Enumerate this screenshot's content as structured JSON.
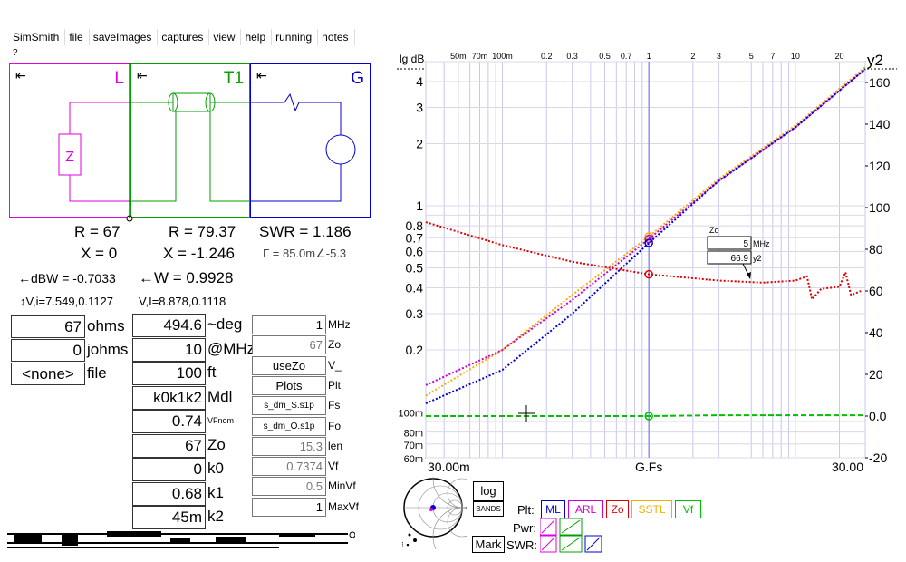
{
  "menu": [
    "SimSmith",
    "file",
    "saveImages",
    "captures",
    "view",
    "help",
    "running",
    "notes"
  ],
  "help_mark": "?",
  "schematic": {
    "L": {
      "label": "L",
      "color": "#e000e0",
      "arrow": "⇤",
      "z_text": "Z"
    },
    "T1": {
      "label": "T1",
      "color": "#00a000",
      "arrow": "⇤"
    },
    "G": {
      "label": "G",
      "color": "#0000d0",
      "arrow": "⇤"
    }
  },
  "readouts": {
    "R_left": "R = 67",
    "X_left": "X = 0",
    "dbw": "←dBW = -0.7033",
    "vi_left": "↕V,i=7.549,0.1127",
    "R_mid": "R = 79.37",
    "X_mid": "X = -1.246",
    "w": "←W = 0.9928",
    "vi_mid": "V,I=8.878,0.1118",
    "swr": "SWR = 1.186",
    "gamma": "Γ = 85.0m∠-5.3"
  },
  "load_fields": [
    {
      "value": "67",
      "label": "ohms"
    },
    {
      "value": "0",
      "label": "johms"
    },
    {
      "value": "<none>",
      "label": "file"
    }
  ],
  "line_fields": [
    {
      "value": "494.6",
      "label": "~deg"
    },
    {
      "value": "10",
      "label": "@MHz"
    },
    {
      "value": "100",
      "label": "ft"
    },
    {
      "value": "k0k1k2",
      "label": "Mdl"
    },
    {
      "value": "0.74",
      "label": "VFnom"
    },
    {
      "value": "67",
      "label": "Zo"
    },
    {
      "value": "0",
      "label": "k0"
    },
    {
      "value": "0.68",
      "label": "k1"
    },
    {
      "value": "45m",
      "label": "k2"
    }
  ],
  "param_fields": [
    {
      "value": "1",
      "label": "MHz",
      "style": "normal"
    },
    {
      "value": "67",
      "label": "Zo",
      "style": "grey"
    },
    {
      "value": "useZo",
      "label": "V_",
      "style": "center"
    },
    {
      "value": "Plots",
      "label": "Plt",
      "style": "center"
    },
    {
      "value": "s_dm_S.s1p",
      "label": "Fs",
      "style": "centersmall"
    },
    {
      "value": "s_dm_O.s1p",
      "label": "Fo",
      "style": "centersmall"
    },
    {
      "value": "15.3",
      "label": "len",
      "style": "grey"
    },
    {
      "value": "0.7374",
      "label": "Vf",
      "style": "grey"
    },
    {
      "value": "0.5",
      "label": "MinVf",
      "style": "grey"
    },
    {
      "value": "1",
      "label": "MaxVf",
      "style": "normal"
    }
  ],
  "chart_data": {
    "type": "line",
    "left_axis_title": "lg dB",
    "right_axis_title": "y2",
    "x_bottom_left": "30.00m",
    "x_bottom_mid": "G.Fs",
    "x_bottom_right": "30.00",
    "x_scale": "log",
    "x_range": [
      0.03,
      30
    ],
    "top_ticks": [
      {
        "label": "50m",
        "x": 0.05
      },
      {
        "label": "70m",
        "x": 0.07
      },
      {
        "label": "100m",
        "x": 0.1
      },
      {
        "label": "0.2",
        "x": 0.2
      },
      {
        "label": "0.3",
        "x": 0.3
      },
      {
        "label": "0.5",
        "x": 0.5
      },
      {
        "label": "0.7",
        "x": 0.7
      },
      {
        "label": "1",
        "x": 1
      },
      {
        "label": "2",
        "x": 2
      },
      {
        "label": "3",
        "x": 3
      },
      {
        "label": "5",
        "x": 5
      },
      {
        "label": "7",
        "x": 7
      },
      {
        "label": "10",
        "x": 10
      },
      {
        "label": "20",
        "x": 20
      }
    ],
    "left_scale": "log",
    "left_range": [
      0.06,
      5
    ],
    "left_ticks": [
      {
        "label": "4",
        "v": 4
      },
      {
        "label": "3",
        "v": 3
      },
      {
        "label": "2",
        "v": 2
      },
      {
        "label": "1",
        "v": 1
      },
      {
        "label": "0.8",
        "v": 0.8
      },
      {
        "label": "0.7",
        "v": 0.7
      },
      {
        "label": "0.6",
        "v": 0.6
      },
      {
        "label": "0.5",
        "v": 0.5
      },
      {
        "label": "0.4",
        "v": 0.4
      },
      {
        "label": "0.3",
        "v": 0.3
      },
      {
        "label": "0.2",
        "v": 0.2
      },
      {
        "label": "100m",
        "v": 0.1
      },
      {
        "label": "80m",
        "v": 0.08
      },
      {
        "label": "70m",
        "v": 0.07
      },
      {
        "label": "60m",
        "v": 0.06
      }
    ],
    "right_range": [
      -20,
      170
    ],
    "right_ticks": [
      160,
      140,
      120,
      100,
      80,
      60,
      40,
      20,
      0,
      -20
    ],
    "right_tick_labels": [
      "160",
      "140",
      "120",
      "100",
      "80",
      "60",
      "40",
      "20",
      "0.0",
      "-20"
    ],
    "series": [
      {
        "name": "SSTL",
        "color": "#f0b000",
        "axis": "left",
        "points": [
          [
            0.03,
            0.12
          ],
          [
            0.1,
            0.2
          ],
          [
            0.3,
            0.37
          ],
          [
            1,
            0.71
          ],
          [
            3,
            1.35
          ],
          [
            10,
            2.45
          ],
          [
            30,
            4.7
          ]
        ]
      },
      {
        "name": "ARL",
        "color": "#d000d0",
        "axis": "left",
        "points": [
          [
            0.03,
            0.135
          ],
          [
            0.1,
            0.2
          ],
          [
            0.3,
            0.35
          ],
          [
            1,
            0.69
          ],
          [
            3,
            1.32
          ],
          [
            10,
            2.4
          ],
          [
            30,
            4.6
          ]
        ]
      },
      {
        "name": "ML",
        "color": "#0000d0",
        "axis": "left",
        "points": [
          [
            0.03,
            0.11
          ],
          [
            0.1,
            0.16
          ],
          [
            0.3,
            0.3
          ],
          [
            1,
            0.66
          ],
          [
            3,
            1.32
          ],
          [
            10,
            2.4
          ],
          [
            30,
            4.6
          ]
        ]
      },
      {
        "name": "Zo",
        "color": "#e00000",
        "axis": "right",
        "points": [
          [
            0.03,
            93
          ],
          [
            0.1,
            82
          ],
          [
            0.3,
            74
          ],
          [
            1,
            68
          ],
          [
            3,
            65
          ],
          [
            6,
            64
          ],
          [
            10,
            65
          ],
          [
            12,
            67
          ],
          [
            13,
            56
          ],
          [
            15,
            61
          ],
          [
            20,
            62
          ],
          [
            22,
            69
          ],
          [
            24,
            58
          ],
          [
            28,
            60
          ]
        ]
      },
      {
        "name": "Vf",
        "color": "#00c000",
        "axis": "right",
        "points": [
          [
            0.03,
            0
          ],
          [
            0.3,
            0
          ],
          [
            1,
            0
          ],
          [
            3,
            0.4
          ],
          [
            10,
            0.4
          ],
          [
            30,
            0.4
          ]
        ]
      }
    ],
    "marker_freq": 1,
    "cursor_box": {
      "title": "Zo",
      "freq": "5",
      "freq_unit": "MHz",
      "value": "66.9",
      "value_unit": "y2"
    }
  },
  "bottom_controls": {
    "log_label": "log",
    "bands_label": "BANDS",
    "mark_label": "Mark",
    "plt_label": "Plt:",
    "pwr_label": "Pwr:",
    "swr_label": "SWR:",
    "plt_buttons": [
      {
        "label": "ML",
        "color": "#0000d0"
      },
      {
        "label": "ARL",
        "color": "#d000d0"
      },
      {
        "label": "Zo",
        "color": "#e00000"
      },
      {
        "label": "SSTL",
        "color": "#f0b000"
      },
      {
        "label": "Vf",
        "color": "#00c000"
      }
    ]
  }
}
